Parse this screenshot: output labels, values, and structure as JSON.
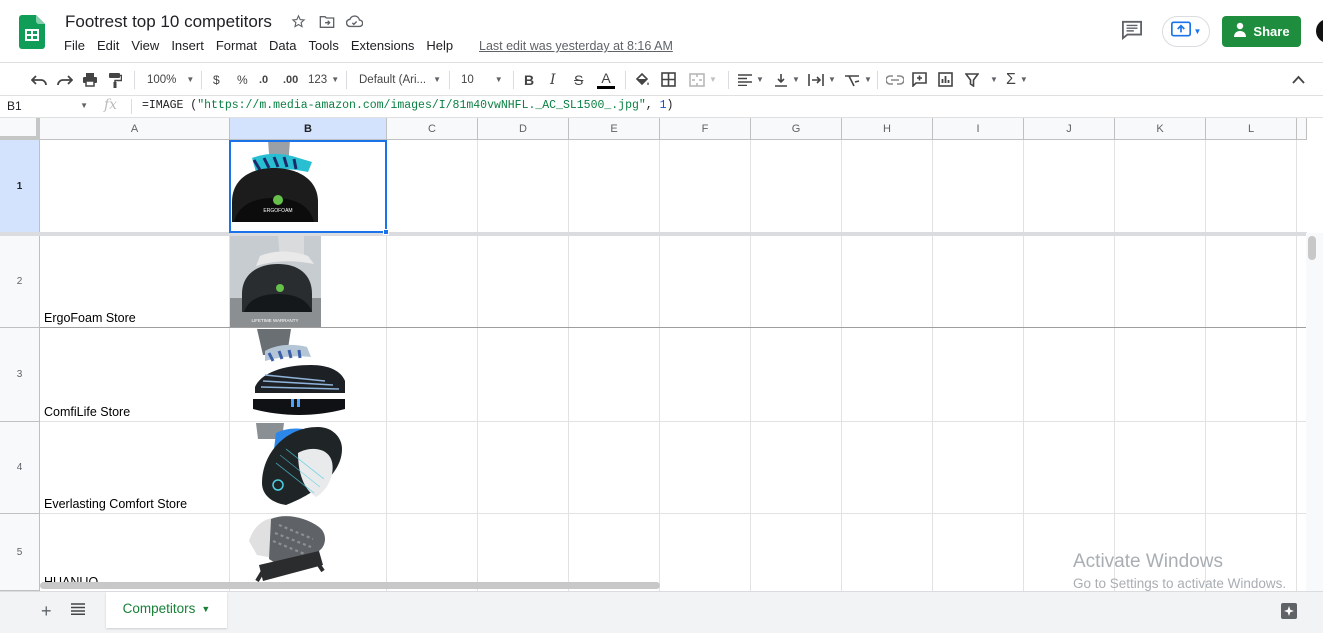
{
  "doc": {
    "title": "Footrest top 10 competitors",
    "last_edit": "Last edit was yesterday at 8:16 AM",
    "share_label": "Share"
  },
  "menu": [
    "File",
    "Edit",
    "View",
    "Insert",
    "Format",
    "Data",
    "Tools",
    "Extensions",
    "Help"
  ],
  "toolbar": {
    "zoom": "100%",
    "currency": "$",
    "percent": "%",
    "decimal_decrease": ".0",
    "decimal_increase": ".00",
    "more_formats": "123",
    "font": "Default (Ari...",
    "font_size": "10"
  },
  "formula_bar": {
    "cell_ref": "B1",
    "fx": "fx",
    "formula_prefix": "=IMAGE (",
    "formula_url": "\"https://m.media-amazon.com/images/I/81m40vwNHFL._AC_SL1500_.jpg\"",
    "formula_sep": ", ",
    "formula_mode": "1",
    "formula_suffix": ")"
  },
  "columns": [
    "A",
    "B",
    "C",
    "D",
    "E",
    "F",
    "G",
    "H",
    "I",
    "J",
    "K",
    "L"
  ],
  "rows": [
    {
      "num": "1",
      "store": "",
      "image": "ErgoFoam footrest on black cushion"
    },
    {
      "num": "2",
      "store": "ErgoFoam Store",
      "image": "ErgoFoam footrest with lifetime warranty"
    },
    {
      "num": "3",
      "store": "ComfiLife Store",
      "image": "ComfiLife striped footrest"
    },
    {
      "num": "4",
      "store": "Everlasting Comfort Store",
      "image": "Everlasting Comfort footrest"
    },
    {
      "num": "5",
      "store": "HUANUO",
      "image": "HUANUO adjustable footrest"
    }
  ],
  "image_overlays": {
    "warranty": "LIFETIME WARRANTY",
    "brand_ergofoam": "ERGOFOAM"
  },
  "watermark": {
    "line1": "Activate Windows",
    "line2": "Go to Settings to activate Windows."
  },
  "sheets": [
    {
      "name": "Competitors",
      "active": true
    }
  ],
  "colors": {
    "accent": "#1a73e8",
    "share_green": "#1e8e3e",
    "sheet_green": "#188038"
  }
}
